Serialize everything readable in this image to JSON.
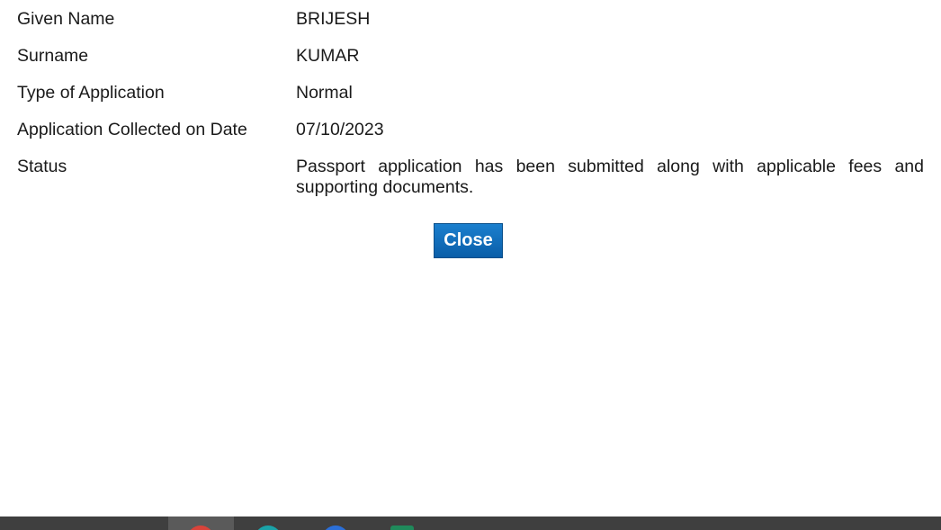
{
  "details": {
    "rows": [
      {
        "label": "Given Name",
        "value": "BRIJESH"
      },
      {
        "label": "Surname",
        "value": "KUMAR"
      },
      {
        "label": "Type of Application",
        "value": "Normal"
      },
      {
        "label": "Application Collected on Date",
        "value": "07/10/2023"
      },
      {
        "label": "Status",
        "value": "Passport application has been submitted along with applicable fees and supporting documents."
      }
    ]
  },
  "actions": {
    "close_label": "Close"
  },
  "colors": {
    "button_top": "#1b7fce",
    "button_bottom": "#0a5ea8",
    "taskbar": "#3f3f3f"
  },
  "taskbar": {
    "icons": [
      "chrome-icon",
      "edge-icon",
      "app-icon-blue",
      "app-icon-green"
    ]
  }
}
